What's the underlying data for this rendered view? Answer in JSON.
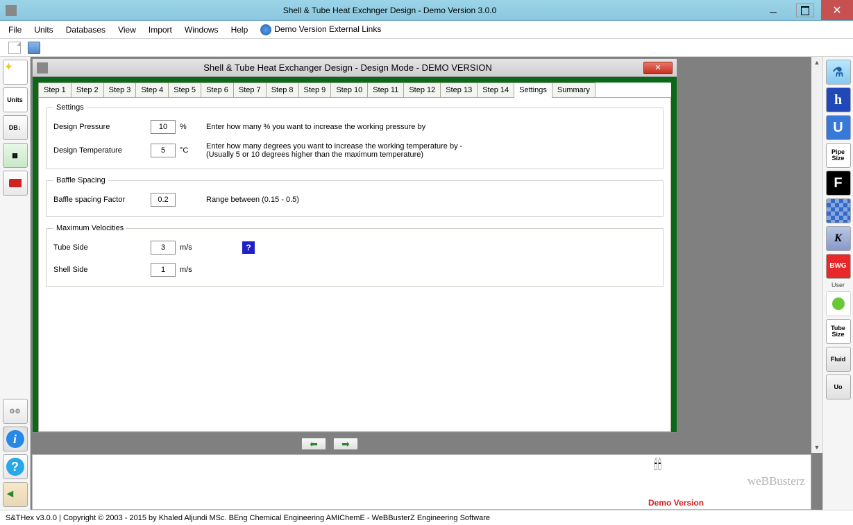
{
  "window": {
    "title": "Shell & Tube Heat Exchnger Design - Demo Version 3.0.0"
  },
  "menubar": {
    "items": [
      "File",
      "Units",
      "Databases",
      "View",
      "Import",
      "Windows",
      "Help"
    ],
    "external_link": "Demo Version External Links"
  },
  "left_toolbar": {
    "units": "Units",
    "db": "DB"
  },
  "right_toolbar": {
    "h": "h",
    "u": "U",
    "pipe": "Pipe\nSize",
    "f": "F",
    "k": "K",
    "bwg": "BWG",
    "user_label": "User",
    "tube": "Tube\nSize",
    "fluid": "Fluid",
    "uo": "Uo"
  },
  "child_window": {
    "title": "Shell & Tube Heat Exchanger Design - Design Mode - DEMO VERSION"
  },
  "tabs": [
    "Step 1",
    "Step 2",
    "Step 3",
    "Step 4",
    "Step 5",
    "Step 6",
    "Step 7",
    "Step 8",
    "Step 9",
    "Step 10",
    "Step 11",
    "Step 12",
    "Step 13",
    "Step 14",
    "Settings",
    "Summary"
  ],
  "settings": {
    "legend": "Settings",
    "design_pressure": {
      "label": "Design Pressure",
      "value": "10",
      "unit": "%",
      "hint": "Enter how many % you want to increase the working pressure by"
    },
    "design_temperature": {
      "label": "Design Temperature",
      "value": "5",
      "unit": "°C",
      "hint": "Enter how many degrees you want to increase the working temperature by - (Usually 5 or 10 degrees higher than the maximum temperature)"
    }
  },
  "baffle": {
    "legend": "Baffle Spacing",
    "factor": {
      "label": "Baffle spacing Factor",
      "value": "0.2",
      "hint": "Range between (0.15 - 0.5)"
    }
  },
  "velocities": {
    "legend": "Maximum Velocities",
    "tube": {
      "label": "Tube Side",
      "value": "3",
      "unit": "m/s"
    },
    "shell": {
      "label": "Shell Side",
      "value": "1",
      "unit": "m/s"
    }
  },
  "bottom": {
    "brand": "weBBusterz",
    "demo": "Demo Version"
  },
  "statusbar": {
    "text": "S&THex  v3.0.0  |  Copyright © 2003 - 2015 by Khaled Aljundi MSc. BEng Chemical Engineering AMIChemE - WeBBusterZ Engineering Software"
  }
}
